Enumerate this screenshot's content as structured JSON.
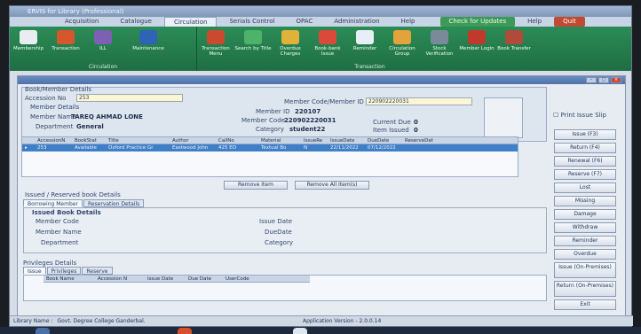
{
  "window": {
    "title": "ERVIS for Library (Professional)"
  },
  "menu": {
    "tabs": [
      "Acquisition",
      "Catalogue",
      "Circulation",
      "Serials Control",
      "OPAC",
      "Administration",
      "Help"
    ],
    "active_tab": "Circulation",
    "check_updates": "Check for Updates",
    "help": "Help",
    "quit": "Quit"
  },
  "ribbon": {
    "groups": [
      {
        "label": "Circulation",
        "buttons": [
          "Membership",
          "Transaction",
          "ILL",
          "Maintenance"
        ]
      },
      {
        "label": "Transaction",
        "buttons": [
          "Transaction Menu",
          "Search by Title",
          "Overdue Charges",
          "Book-bank Issue",
          "Reminder",
          "Circulation Group",
          "Stock Verification",
          "Member Login",
          "Book Transfer"
        ]
      }
    ]
  },
  "form": {
    "book_member_title": "Book/Member Details",
    "accession_label": "Accession No",
    "accession_value": "253",
    "member_code_label": "Member Code/Member ID",
    "member_code_value": "220902220031",
    "member_details_title": "Member Details",
    "member_name_label": "Member Name",
    "member_name_value": "TAREQ AHMAD LONE",
    "department_label": "Department",
    "department_value": "General",
    "member_id_label": "Member ID",
    "member_id_value": "220107",
    "mcode_label": "Member Code",
    "mcode_value": "220902220031",
    "category_label": "Category",
    "category_value": "student22",
    "current_due_label": "Current Due",
    "current_due_value": "0",
    "items_issued_label": "Item Issued",
    "items_issued_value": "0",
    "print_slip": "Print Issue Slip"
  },
  "grid": {
    "columns": [
      "AccessionN",
      "BookStat",
      "Title",
      "Author",
      "CallNo",
      "Material",
      "IssueRe",
      "IssueDate",
      "DueDate",
      "ReserveDat"
    ],
    "rows": [
      [
        "253",
        "Available",
        "Oxford Practice Gr",
        "Eastwood John",
        "425 EO",
        "Textual Bo",
        "N",
        "22/11/2022",
        "07/12/2022",
        ""
      ]
    ]
  },
  "buttons": {
    "remove_item": "Remove Item",
    "remove_all": "Remove All Item(s)"
  },
  "issued": {
    "title": "Issued / Reserved book Details",
    "tabs": [
      "Borrowing Member",
      "Reservation Details"
    ],
    "group_title": "Issued Book Details",
    "member_code": "Member Code",
    "member_name": "Member Name",
    "department": "Department",
    "issue_date": "Issue Date",
    "due_date": "DueDate",
    "category": "Category"
  },
  "privileges": {
    "title": "Privileges Details",
    "tabs": [
      "Issue",
      "Privileges",
      "Reserve"
    ],
    "columns": [
      "Book Name",
      "Accession N",
      "Issue Date",
      "Due Date",
      "UserCode"
    ]
  },
  "sidebar": [
    "Issue (F3)",
    "Return (F4)",
    "Renewal (F6)",
    "Reserve (F7)",
    "Lost",
    "Missing",
    "Damage",
    "Withdraw",
    "Reminder",
    "Overdue",
    "Issue (On-Premises)",
    "Return (On-Premises)",
    "Exit"
  ],
  "status": {
    "library_label": "Library Name :",
    "library_value": "Govt. Degree College Ganderbal.",
    "version": "Application Version - 2.0.0.14"
  },
  "colors": {
    "ribbon": "#2b8c56",
    "selection": "#3f7fc8",
    "accent_red": "#c14a32"
  }
}
